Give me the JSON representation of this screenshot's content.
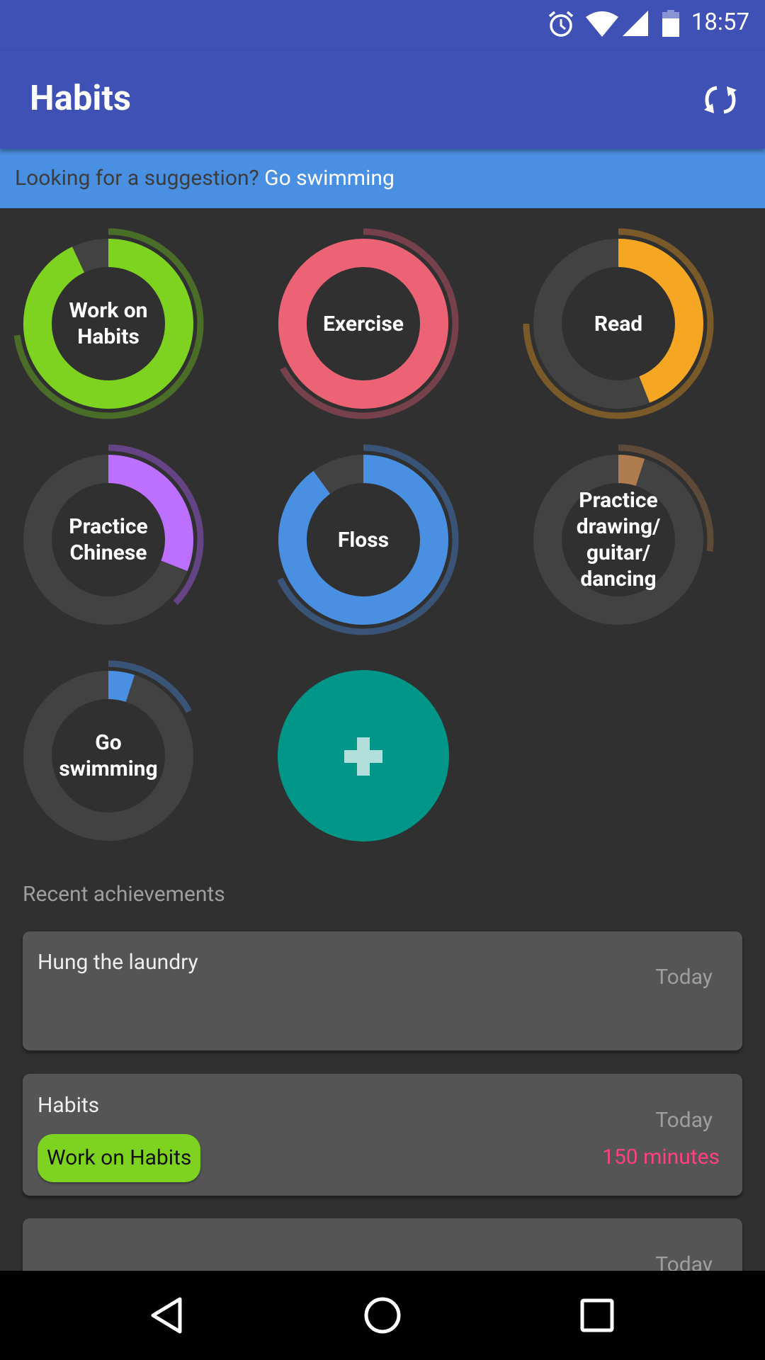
{
  "status_bar": {
    "time": "18:57",
    "icons": [
      "alarm-icon",
      "wifi-icon",
      "cell-signal-icon",
      "battery-icon"
    ]
  },
  "app_bar": {
    "title": "Habits",
    "action_icon": "sync-icon"
  },
  "suggestion": {
    "prompt": "Looking for a suggestion?",
    "habit": "Go swimming"
  },
  "colors": {
    "primary": "#3f51b5",
    "suggestion_bg": "#4a90e2",
    "background": "#303030",
    "track": "#424242",
    "fab": "#009688",
    "accent_pink": "#ff4081"
  },
  "habits": [
    {
      "label": "Work on Habits",
      "color": "#7ed321",
      "dim_color": "#4a6d28",
      "progress": 0.93,
      "outer_progress": 0.73
    },
    {
      "label": "Exercise",
      "color": "#eb6374",
      "dim_color": "#76414b",
      "progress": 1.0,
      "outer_progress": 0.67
    },
    {
      "label": "Read",
      "color": "#f5a623",
      "dim_color": "#7a5a28",
      "progress": 0.44,
      "outer_progress": 0.75
    },
    {
      "label": "Practice Chinese",
      "color": "#bd6fff",
      "dim_color": "#654486",
      "progress": 0.31,
      "outer_progress": 0.37
    },
    {
      "label": "Floss",
      "color": "#4a90e2",
      "dim_color": "#3a5478",
      "progress": 0.9,
      "outer_progress": 0.68
    },
    {
      "label": "Practice drawing/ guitar/ dancing",
      "color": "#ae7c4e",
      "dim_color": "#5e4a38",
      "progress": 0.05,
      "outer_progress": 0.27
    },
    {
      "label": "Go swimming",
      "color": "#4a90e2",
      "dim_color": "#3a5478",
      "progress": 0.05,
      "outer_progress": 0.17
    }
  ],
  "add_habit": {
    "icon": "plus-icon"
  },
  "recent": {
    "title": "Recent achievements",
    "items": [
      {
        "title": "Hung the laundry",
        "date": "Today"
      },
      {
        "title": "Habits",
        "date": "Today",
        "chip": "Work on Habits",
        "chip_color": "#7ed321",
        "duration": "150 minutes"
      },
      {
        "title": "",
        "date": "Today"
      }
    ]
  },
  "nav_bar": {
    "buttons": [
      "back-icon",
      "home-icon",
      "recents-icon"
    ]
  }
}
